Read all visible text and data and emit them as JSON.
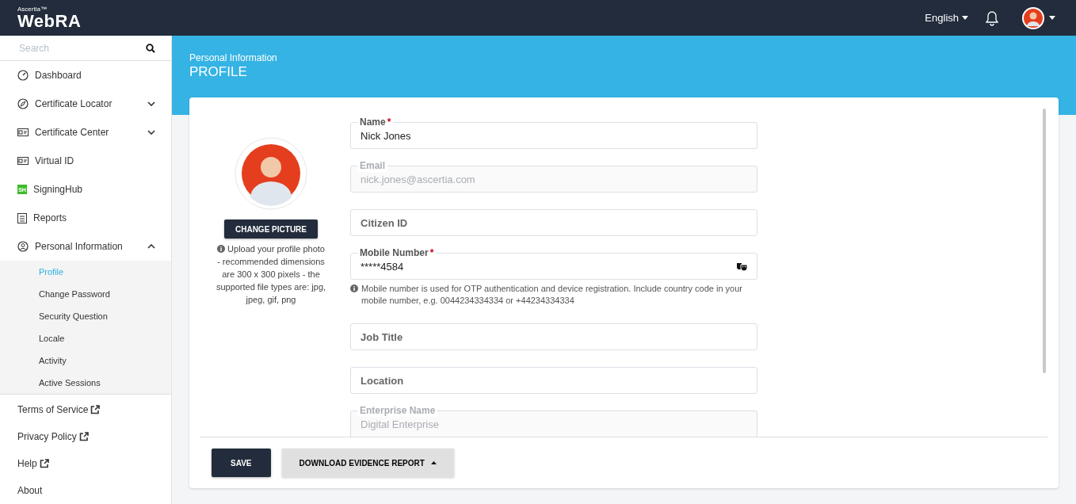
{
  "header": {
    "brand_small": "Ascertia™",
    "brand": "WebRA",
    "language": "English"
  },
  "sidebar": {
    "search": {
      "placeholder": "Search"
    },
    "items": [
      {
        "kind": "page",
        "label": "Dashboard"
      },
      {
        "kind": "group",
        "label": "Certificate Locator",
        "expanded": false
      },
      {
        "kind": "group",
        "label": "Certificate Center",
        "expanded": false
      },
      {
        "kind": "page",
        "label": "Virtual ID"
      },
      {
        "kind": "page",
        "label": "SigningHub",
        "badge": "SH"
      },
      {
        "kind": "page",
        "label": "Reports"
      },
      {
        "kind": "group",
        "label": "Personal Information",
        "expanded": true,
        "children": [
          {
            "label": "Profile",
            "selected": true
          },
          {
            "label": "Change Password",
            "selected": false
          },
          {
            "label": "Security Question",
            "selected": false
          },
          {
            "label": "Locale",
            "selected": false
          },
          {
            "label": "Activity",
            "selected": false
          },
          {
            "label": "Active Sessions",
            "selected": false
          }
        ]
      }
    ],
    "links": [
      {
        "label": "Terms of Service",
        "external": true
      },
      {
        "label": "Privacy Policy",
        "external": true
      },
      {
        "label": "Help",
        "external": true
      },
      {
        "label": "About",
        "external": false
      }
    ]
  },
  "page": {
    "breadcrumb": "Personal Information",
    "title": "PROFILE"
  },
  "profile": {
    "change_picture": "CHANGE PICTURE",
    "upload_hint": "Upload your profile photo - recommended dimensions are 300 x 300 pixels - the supported file types are: jpg, jpeg, gif, png"
  },
  "required_mark": "*",
  "fields": [
    {
      "label": "Name",
      "value": "Nick Jones",
      "required": true,
      "disabled": false
    },
    {
      "label": "Email",
      "value": "nick.jones@ascertia.com",
      "required": false,
      "disabled": true
    },
    {
      "label": "Citizen ID",
      "required": false,
      "disabled": false
    },
    {
      "label": "Mobile Number",
      "value": "*****4584",
      "required": true,
      "disabled": false,
      "masked": true,
      "hint": "Mobile number is used for OTP authentication and device registration. Include country code in your mobile number, e.g. 0044234334334 or +44234334334"
    },
    {
      "label": "Job Title",
      "required": false,
      "disabled": false
    },
    {
      "label": "Location",
      "required": false,
      "disabled": false
    },
    {
      "label": "Enterprise Name",
      "value": "Digital Enterprise",
      "required": false,
      "disabled": true
    }
  ],
  "buttons": {
    "save": "SAVE",
    "download": "DOWNLOAD EVIDENCE REPORT"
  }
}
